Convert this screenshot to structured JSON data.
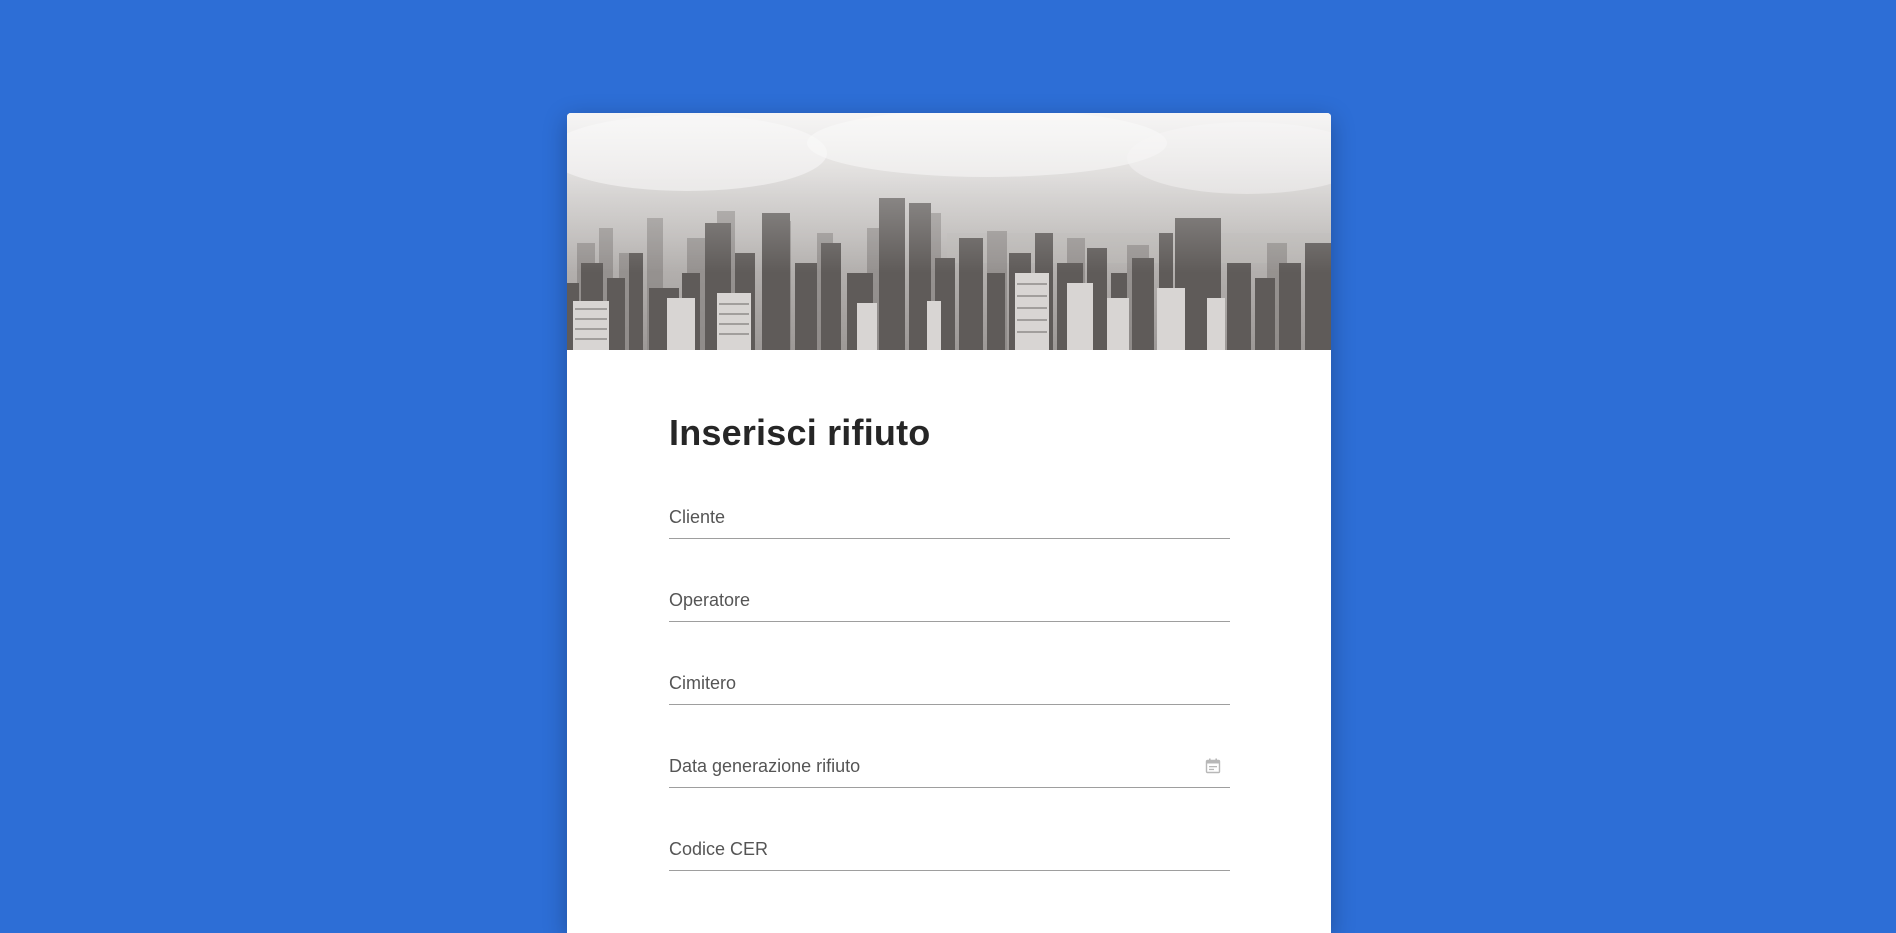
{
  "form": {
    "title": "Inserisci rifiuto",
    "fields": [
      {
        "label": "Cliente"
      },
      {
        "label": "Operatore"
      },
      {
        "label": "Cimitero"
      },
      {
        "label": "Data generazione rifiuto",
        "icon": "calendar-icon"
      },
      {
        "label": "Codice CER"
      }
    ]
  },
  "colors": {
    "background": "#2d6ed6",
    "card": "#ffffff",
    "title": "#262626",
    "label": "#555555",
    "underline": "#9e9e9e"
  },
  "banner": {
    "image": "city-skyline-image"
  }
}
